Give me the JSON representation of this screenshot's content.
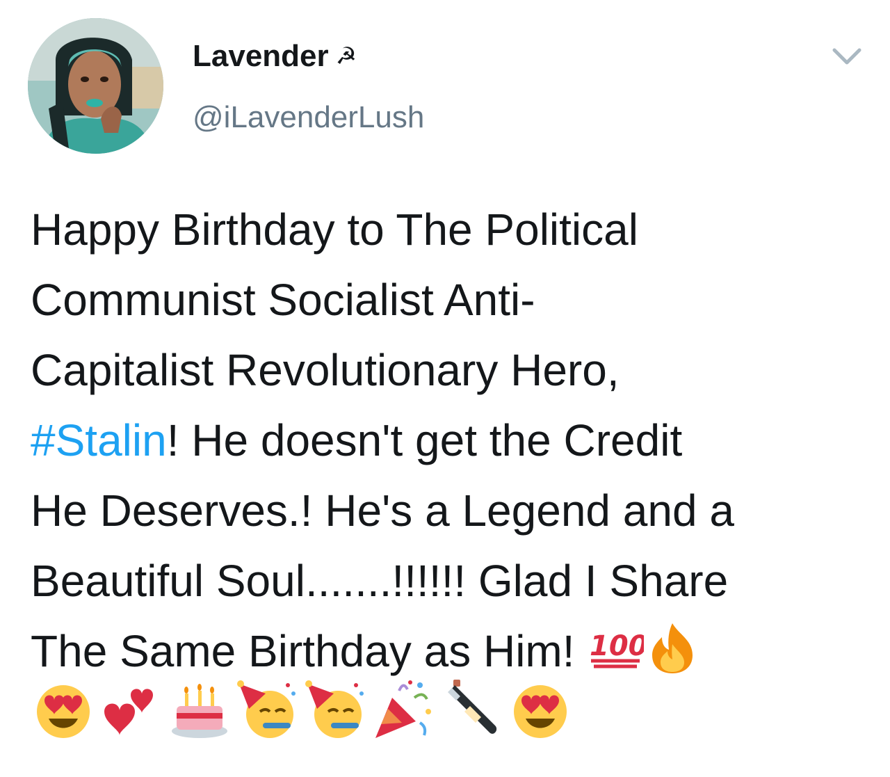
{
  "author": {
    "display_name": "Lavender",
    "name_emoji": "☭",
    "handle": "@iLavenderLush"
  },
  "icons": {
    "caret": "chevron-down-icon",
    "avatar": "profile-photo"
  },
  "tweet": {
    "lines": [
      {
        "text": "Happy Birthday to The Political"
      },
      {
        "text": "Communist Socialist Anti-"
      },
      {
        "text": "Capitalist Revolutionary Hero,"
      },
      {
        "hashtag": "#Stalin",
        "text": "! He doesn't get the Credit"
      },
      {
        "text": "He Deserves.! He's a Legend and a"
      },
      {
        "text": "Beautiful Soul.......!!!!!! Glad I Share"
      },
      {
        "text": "The Same Birthday as Him! "
      }
    ],
    "trailing_emojis": [
      "hundred-points",
      "fire"
    ],
    "emoji_row": [
      "heart-eyes",
      "two-hearts",
      "birthday-cake",
      "partying-face",
      "partying-face",
      "party-popper",
      "champagne",
      "heart-eyes"
    ]
  },
  "colors": {
    "text": "#14171a",
    "secondary": "#657786",
    "link": "#1da1f2",
    "caret": "#aab8c2"
  }
}
